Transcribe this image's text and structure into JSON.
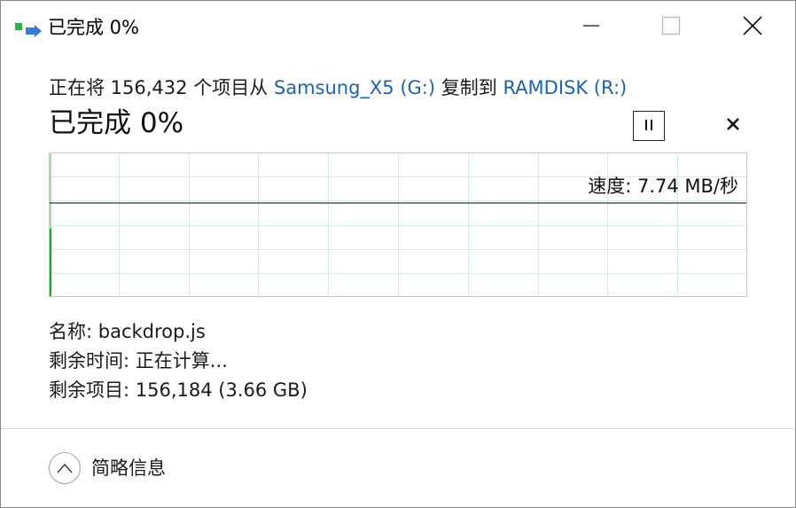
{
  "window": {
    "title": "已完成 0%",
    "icons": {
      "app": "copy-arrow-icon",
      "minimize": "minimize-icon",
      "maximize": "maximize-icon",
      "close": "close-icon"
    }
  },
  "copy": {
    "prefix": "正在将 156,432 个项目从 ",
    "source": "Samsung_X5 (G:)",
    "middle": " 复制到 ",
    "destination": "RAMDISK (R:)"
  },
  "status": {
    "percent_text": "已完成 0%",
    "progress_percent": 0,
    "pause_icon": "pause-icon",
    "cancel_icon": "cancel-x-icon"
  },
  "graph": {
    "speed_text": "速度: 7.74 MB/秒",
    "gridline_color": "#d4ecd9",
    "fill_color": "#06b025",
    "speed_line_color": "#000000"
  },
  "details": {
    "name_label": "名称: ",
    "name_value": "backdrop.js",
    "time_label": "剩余时间: ",
    "time_value": "正在计算...",
    "items_label": "剩余项目: ",
    "items_value": "156,184 (3.66 GB)"
  },
  "footer": {
    "toggle_label": "简略信息",
    "toggle_icon": "chevron-up-icon"
  },
  "colors": {
    "link": "#1a64b4",
    "progress_green": "#06b025"
  }
}
